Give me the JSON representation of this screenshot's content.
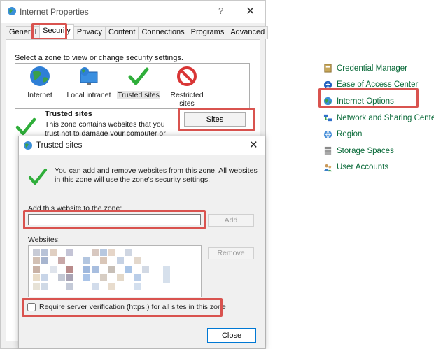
{
  "control_panel": {
    "items": [
      {
        "label": "Credential Manager",
        "icon": "credential-manager-icon"
      },
      {
        "label": "Ease of Access Center",
        "icon": "ease-of-access-icon"
      },
      {
        "label": "Internet Options",
        "icon": "internet-options-icon"
      },
      {
        "label": "Network and Sharing Center",
        "icon": "network-sharing-icon"
      },
      {
        "label": "Region",
        "icon": "region-icon"
      },
      {
        "label": "Storage Spaces",
        "icon": "storage-spaces-icon"
      },
      {
        "label": "User Accounts",
        "icon": "user-accounts-icon"
      }
    ],
    "link_color": "#0b6b3a"
  },
  "internet_properties": {
    "title": "Internet Properties",
    "help": "?",
    "close": "✕",
    "tabs": [
      "General",
      "Security",
      "Privacy",
      "Content",
      "Connections",
      "Programs",
      "Advanced"
    ],
    "active_tab": "Security",
    "zone_prompt": "Select a zone to view or change security settings.",
    "zones": [
      {
        "label": "Internet",
        "icon": "globe-icon"
      },
      {
        "label": "Local intranet",
        "icon": "monitor-globe-icon"
      },
      {
        "label": "Trusted sites",
        "icon": "checkmark-icon"
      },
      {
        "label": "Restricted sites",
        "icon": "restricted-icon"
      }
    ],
    "selected_zone": {
      "title": "Trusted sites",
      "description": "This zone contains websites that you trust not to damage your computer or"
    },
    "sites_button": "Sites"
  },
  "trusted_sites_dialog": {
    "title": "Trusted sites",
    "close": "✕",
    "info": "You can add and remove websites from this zone. All websites in this zone will use the zone's security settings.",
    "add_label": "Add this website to the zone:",
    "add_value": "",
    "add_button": "Add",
    "websites_label": "Websites:",
    "remove_button": "Remove",
    "verify_label": "Require server verification (https:) for all sites in this zone",
    "verify_checked": false,
    "close_button": "Close"
  },
  "highlight_color": "#d9534f"
}
